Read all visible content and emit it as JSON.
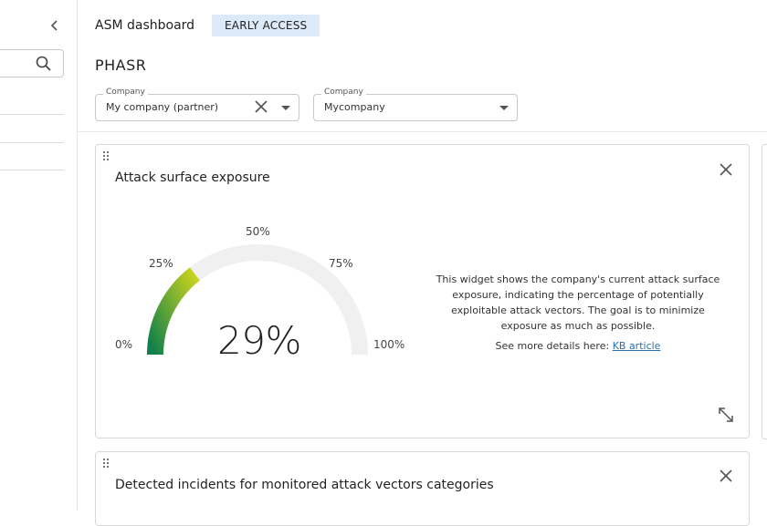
{
  "header": {
    "title": "ASM dashboard",
    "badge": "EARLY ACCESS"
  },
  "page": {
    "title": "PHASR"
  },
  "filters": [
    {
      "label": "Company",
      "value": "My company (partner)"
    },
    {
      "label": "Company",
      "value": "Mycompany"
    }
  ],
  "widgets": [
    {
      "title": "Attack surface exposure",
      "gauge": {
        "value_percent": 29,
        "value_label": "29%",
        "tick_labels": [
          "0%",
          "25%",
          "50%",
          "75%",
          "100%"
        ]
      },
      "description": "This widget shows the company's current attack surface exposure, indicating the percentage of potentially exploitable attack vectors. The goal is to minimize exposure as much as possible.",
      "more_prefix": "See more details here: ",
      "more_link": "KB article"
    },
    {
      "title": "Detected incidents for monitored attack vectors categories"
    }
  ],
  "colors": {
    "badge_bg": "#dce9f8",
    "gauge_track": "#f0f0f0",
    "gauge_start": "#11804a",
    "gauge_end": "#c9d41e",
    "link": "#2a6fb0"
  }
}
